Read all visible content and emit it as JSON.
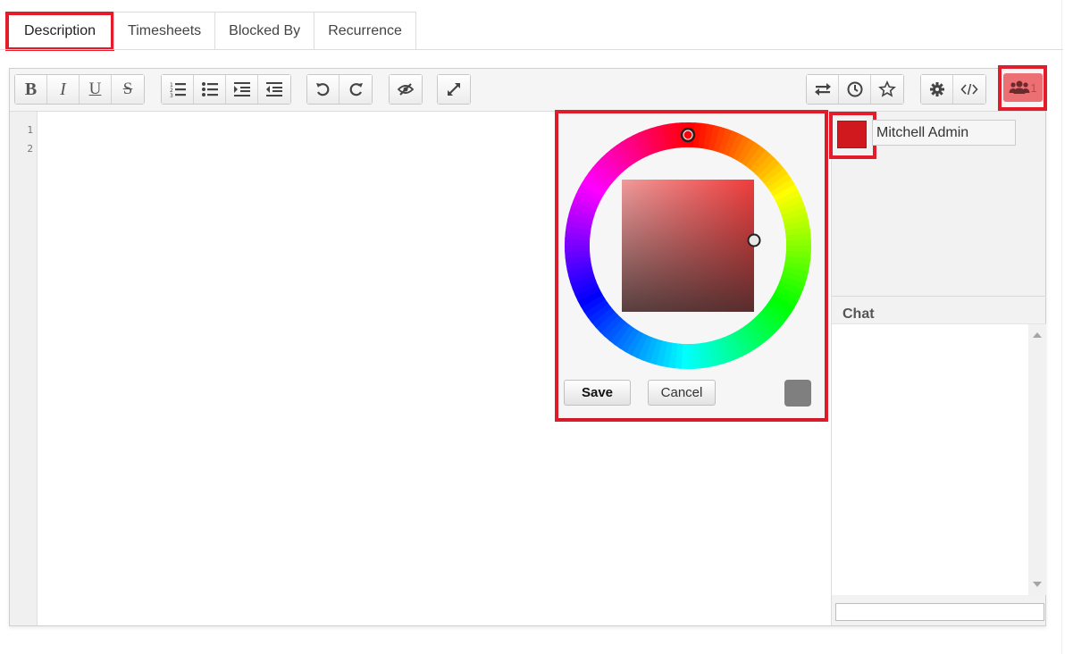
{
  "tabs": [
    {
      "label": "Description",
      "active": true
    },
    {
      "label": "Timesheets",
      "active": false
    },
    {
      "label": "Blocked By",
      "active": false
    },
    {
      "label": "Recurrence",
      "active": false
    }
  ],
  "toolbar": {
    "bold": "B",
    "italic": "I",
    "underline": "U",
    "strike": "S",
    "users_count": "1"
  },
  "editor": {
    "line_numbers": [
      "1",
      "2"
    ]
  },
  "collab": {
    "user_name": "Mitchell Admin",
    "user_color": "#d0191f",
    "chat_label": "Chat"
  },
  "color_picker": {
    "save_label": "Save",
    "cancel_label": "Cancel",
    "preview_color": "#7f7f7f"
  },
  "colors": {
    "highlight": "#e31c2b",
    "users_button": "#ec6f74"
  }
}
